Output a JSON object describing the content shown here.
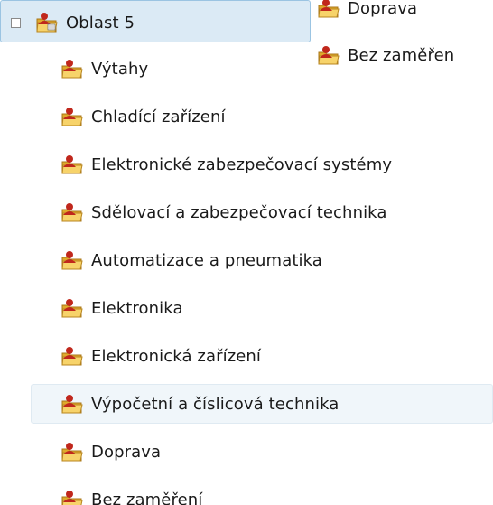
{
  "tree": {
    "root": {
      "label": "Oblast 5",
      "icon": "folder-user-icon",
      "expanded": true,
      "toggle_glyph": "−"
    },
    "children": [
      {
        "label": "Výtahy",
        "icon": "folder-user-icon"
      },
      {
        "label": "Chladící zařízení",
        "icon": "folder-user-icon"
      },
      {
        "label": "Elektronické zabezpečovací systémy",
        "icon": "folder-user-icon"
      },
      {
        "label": "Sdělovací a zabezpečovací technika",
        "icon": "folder-user-icon"
      },
      {
        "label": "Automatizace a pneumatika",
        "icon": "folder-user-icon"
      },
      {
        "label": "Elektronika",
        "icon": "folder-user-icon"
      },
      {
        "label": "Elektronická zařízení",
        "icon": "folder-user-icon"
      },
      {
        "label": "Výpočetní a číslicová technika",
        "icon": "folder-user-icon",
        "selected": true
      },
      {
        "label": "Doprava",
        "icon": "folder-user-icon"
      },
      {
        "label": "Bez zaměření",
        "icon": "folder-user-icon"
      }
    ]
  },
  "right_column": {
    "items": [
      {
        "label": "Doprava",
        "icon": "folder-user-icon"
      },
      {
        "label": "Bez zaměřen",
        "icon": "folder-user-icon"
      }
    ]
  },
  "colors": {
    "root_highlight": "#dbeaf5",
    "root_border": "#9bc4e2",
    "hover_row": "#f0f6fa",
    "folder": "#f2c44e",
    "user_icon": "#c0271c"
  }
}
